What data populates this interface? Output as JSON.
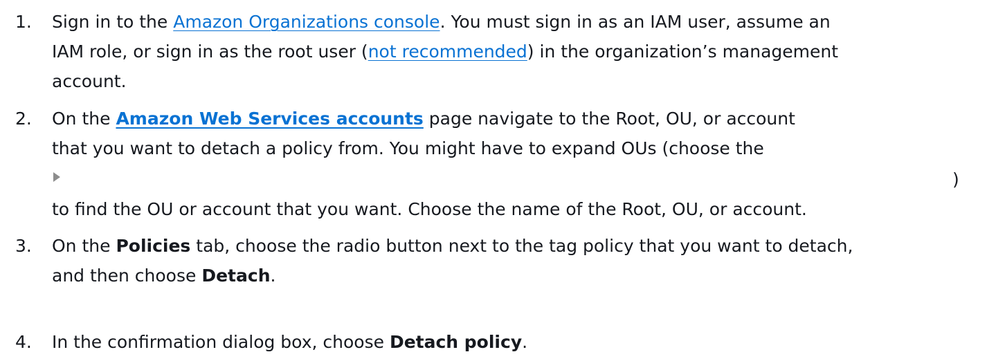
{
  "steps": [
    {
      "number": "1.",
      "line1_a": "Sign in to the ",
      "link1": "Amazon Organizations console",
      "line1_b": ". You must sign in as an IAM user, assume an",
      "line2_a": "IAM role, or sign in as the root user (",
      "link2": "not recommended",
      "line2_b": ") in the organization’s management",
      "line3": "account."
    },
    {
      "number": "2.",
      "line1_pre": "On the ",
      "link": "Amazon Web Services accounts",
      "line1_post": " page navigate to the Root, OU, or account",
      "line2": "that you want to detach a policy from. You might have to expand OUs (choose the",
      "icon": "expand-triangle-icon",
      "close_paren": ")",
      "line4": "to find the OU or account that you want. Choose the name of the Root, OU, or account."
    },
    {
      "number": "3.",
      "line1_pre": "On the ",
      "bold1": "Policies",
      "line1_post": " tab, choose the radio button next to the tag policy that you want to detach,",
      "line2_pre": "and then choose ",
      "bold2": "Detach",
      "line2_post": "."
    },
    {
      "number": "4.",
      "line1_pre": "In the confirmation dialog box, choose ",
      "bold": "Detach policy",
      "line1_post": "."
    }
  ],
  "colors": {
    "text": "#16191f",
    "link": "#0972d3"
  }
}
